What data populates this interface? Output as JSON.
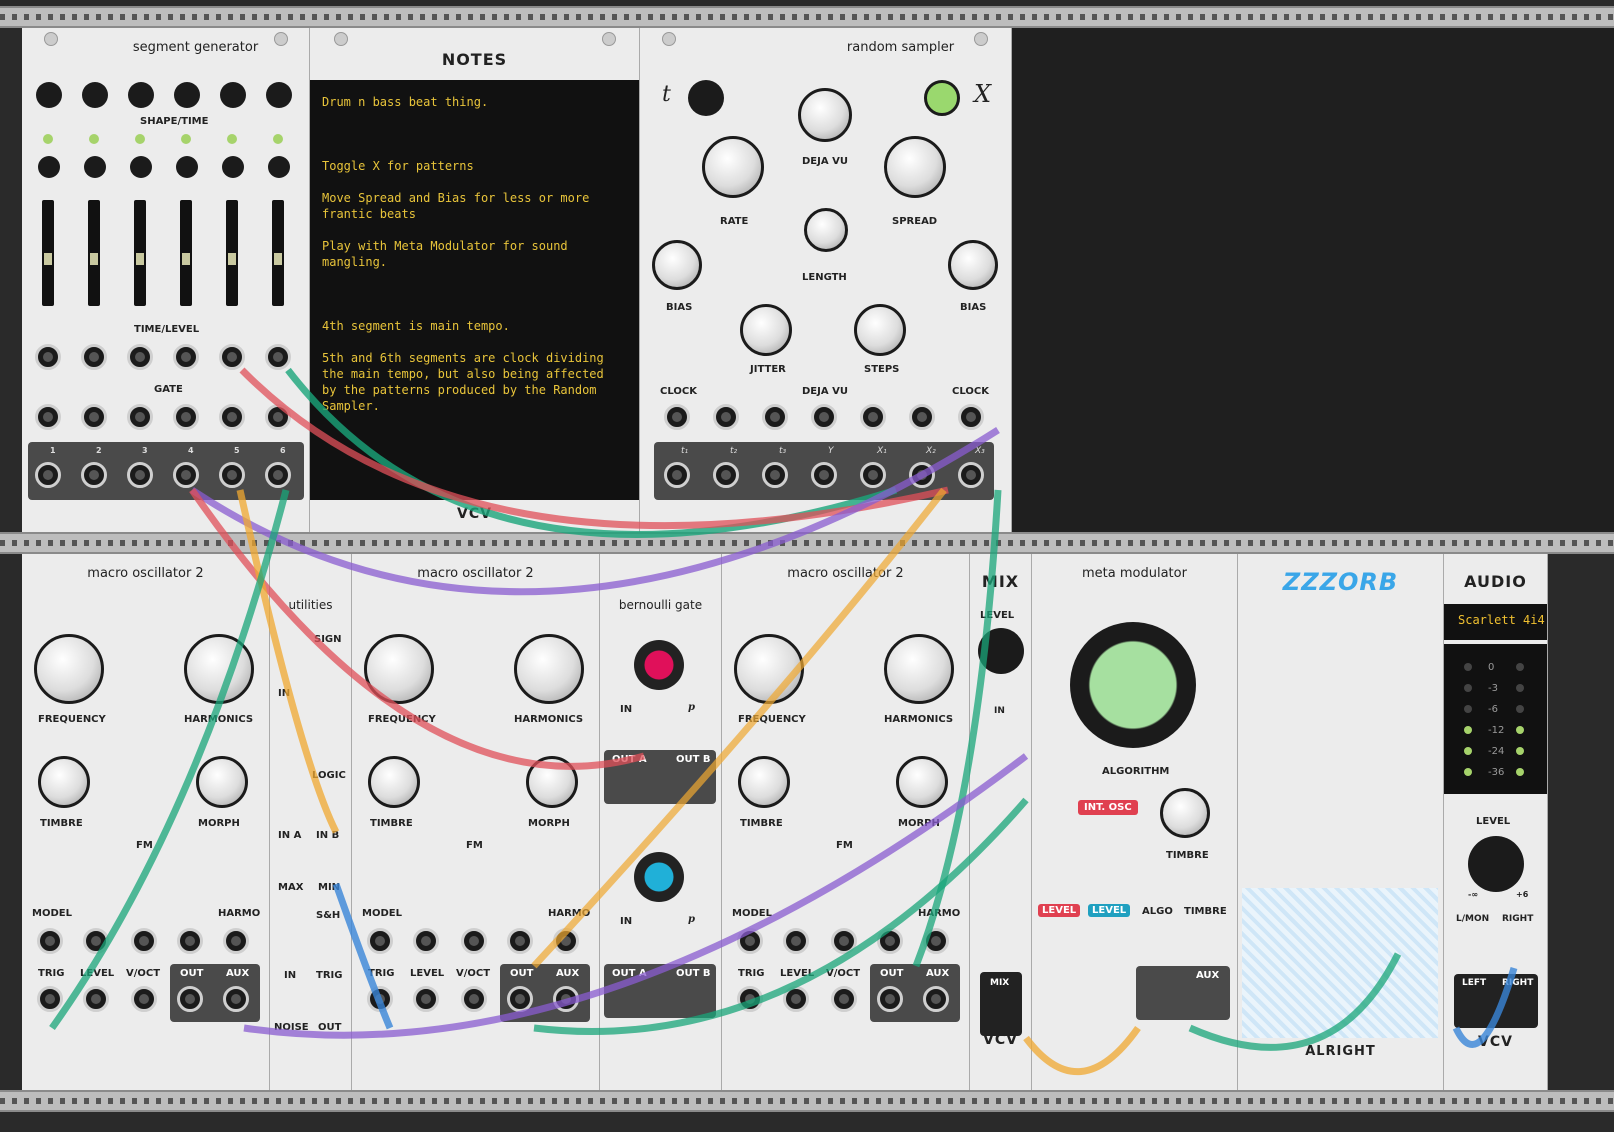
{
  "modules": {
    "segment_generator": {
      "title": "segment generator",
      "shape_time": "SHAPE/TIME",
      "time_level": "TIME/LEVEL",
      "gate": "GATE",
      "outputs": [
        "1",
        "2",
        "3",
        "4",
        "5",
        "6"
      ]
    },
    "notes": {
      "title": "NOTES",
      "text": "Drum n bass beat thing.\n\n\n\nToggle X for patterns\n\nMove Spread and Bias for less or more\nfrantic beats\n\nPlay with Meta Modulator for sound\nmangling.\n\n\n\n4th segment is main tempo.\n\n5th and 6th segments are clock dividing\nthe main tempo, but also being affected\nby the patterns produced by the Random\nSampler.",
      "brand": "VCV"
    },
    "random_sampler": {
      "title": "random sampler",
      "t": "t",
      "x": "X",
      "deja_vu": "DEJA VU",
      "rate": "RATE",
      "spread": "SPREAD",
      "length": "LENGTH",
      "bias": "BIAS",
      "jitter": "JITTER",
      "steps": "STEPS",
      "clock": "CLOCK",
      "outputs": [
        "t₁",
        "t₂",
        "t₃",
        "Y",
        "X₁",
        "X₂",
        "X₃"
      ]
    },
    "macro_osc": {
      "title": "macro oscillator 2",
      "frequency": "FREQUENCY",
      "harmonics": "HARMONICS",
      "timbre": "TIMBRE",
      "morph": "MORPH",
      "fm": "FM",
      "model": "MODEL",
      "harmo": "HARMO",
      "trig": "TRIG",
      "level": "LEVEL",
      "voct": "V/OCT",
      "out": "OUT",
      "aux": "AUX"
    },
    "utilities": {
      "title": "utilities",
      "sign": "SIGN",
      "in": "IN",
      "logic": "LOGIC",
      "in_a": "IN A",
      "in_b": "IN B",
      "max": "MAX",
      "min": "MIN",
      "sh": "S&H",
      "trig": "TRIG",
      "noise": "NOISE",
      "out": "OUT"
    },
    "bernoulli": {
      "title": "bernoulli gate",
      "in": "IN",
      "p": "p",
      "out_a": "OUT A",
      "out_b": "OUT B"
    },
    "mix": {
      "title": "MIX",
      "level": "LEVEL",
      "in": "IN",
      "mix": "MIX",
      "brand": "VCV"
    },
    "meta_modulator": {
      "title": "meta modulator",
      "algorithm": "ALGORITHM",
      "int_osc": "INT. OSC",
      "timbre": "TIMBRE",
      "level": "LEVEL",
      "algo": "ALGO",
      "aux": "AUX"
    },
    "zzzorb": {
      "title": "ZZZORB",
      "brand": "ALRIGHT"
    },
    "audio": {
      "title": "AUDIO",
      "device": "Scarlett 4i4",
      "vu_levels": [
        "0",
        "-3",
        "-6",
        "-12",
        "-24",
        "-36"
      ],
      "level": "LEVEL",
      "l_mon": "L/MON",
      "right": "RIGHT",
      "out_left": "LEFT",
      "out_right": "RIGHT",
      "scale_min": "-∞",
      "scale_max": "+6",
      "brand": "VCV"
    }
  },
  "colors": {
    "green": "#1aa57a",
    "red": "#e0505a",
    "purple": "#8a5cd0",
    "orange": "#f0a830",
    "blue": "#3a86d8",
    "panel": "#ececec"
  }
}
